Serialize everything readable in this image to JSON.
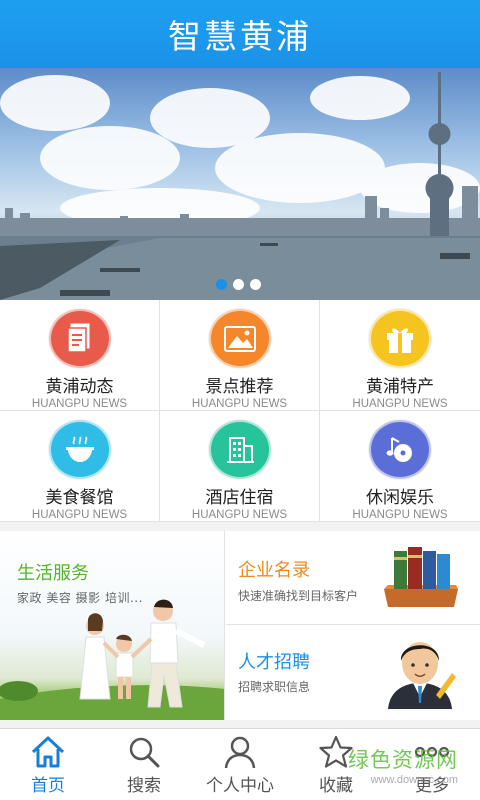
{
  "header": {
    "title": "智慧黄浦"
  },
  "banner": {
    "slides": 3,
    "active_slide": 1
  },
  "grid": {
    "items": [
      {
        "label": "黄浦动态",
        "sub": "HUANGPU NEWS",
        "icon": "document-icon",
        "color": "#e85a4a"
      },
      {
        "label": "景点推荐",
        "sub": "HUANGPU NEWS",
        "icon": "landscape-icon",
        "color": "#f5862a"
      },
      {
        "label": "黄浦特产",
        "sub": "HUANGPU NEWS",
        "icon": "gift-icon",
        "color": "#f5c41f"
      },
      {
        "label": "美食餐馆",
        "sub": "HUANGPU NEWS",
        "icon": "bowl-icon",
        "color": "#2fbde8"
      },
      {
        "label": "酒店住宿",
        "sub": "HUANGPU NEWS",
        "icon": "building-icon",
        "color": "#27c39a"
      },
      {
        "label": "休闲娱乐",
        "sub": "HUANGPU NEWS",
        "icon": "music-disc-icon",
        "color": "#5b6ed8"
      }
    ]
  },
  "services": {
    "life": {
      "title": "生活服务",
      "sub": "家政 美容 摄影 培训..."
    },
    "business": {
      "title": "企业名录",
      "sub": "快速准确找到目标客户"
    },
    "jobs": {
      "title": "人才招聘",
      "sub": "招聘求职信息"
    }
  },
  "tabbar": {
    "items": [
      {
        "label": "首页",
        "icon": "home-icon",
        "active": true
      },
      {
        "label": "搜索",
        "icon": "search-icon",
        "active": false
      },
      {
        "label": "个人中心",
        "icon": "user-icon",
        "active": false
      },
      {
        "label": "收藏",
        "icon": "star-icon",
        "active": false
      },
      {
        "label": "更多",
        "icon": "more-icon",
        "active": false
      }
    ]
  },
  "watermark": {
    "main": "绿色资源网",
    "sub": "www.downcc.com"
  },
  "colors": {
    "primary": "#1a92e8",
    "green": "#58b12b",
    "orange": "#f08a1c"
  }
}
